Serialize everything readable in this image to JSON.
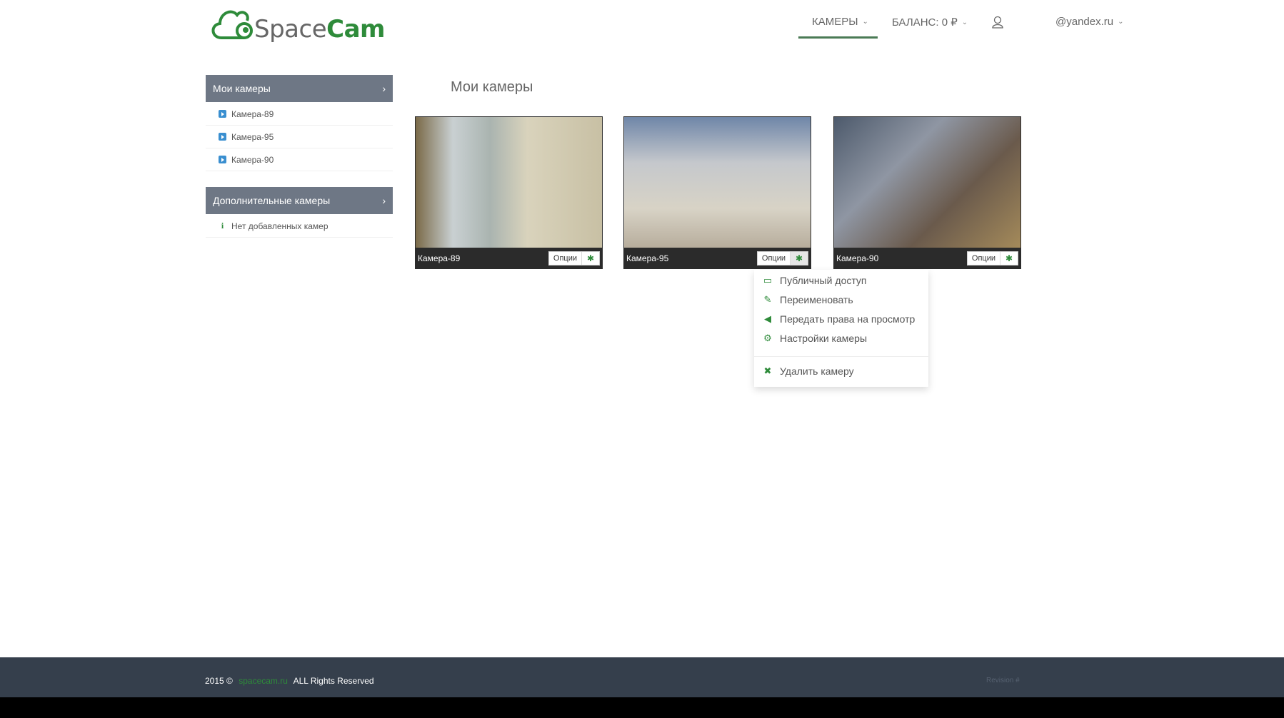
{
  "brand": {
    "name_light": "Space",
    "name_bold": "Cam",
    "color": "#2e8b3a"
  },
  "nav": {
    "cameras": "КАМЕРЫ",
    "balance": "БАЛАНС: 0 ₽",
    "user": "@yandex.ru"
  },
  "sidebar": {
    "my_header": "Мои камеры",
    "my_items": [
      {
        "label": "Камера-89"
      },
      {
        "label": "Камера-95"
      },
      {
        "label": "Камера-90"
      }
    ],
    "extra_header": "Дополнительные камеры",
    "extra_empty": "Нет добавленных камер"
  },
  "main": {
    "title": "Мои камеры",
    "cameras": [
      {
        "name": "Камера-89",
        "options": "Опции"
      },
      {
        "name": "Камера-95",
        "options": "Опции"
      },
      {
        "name": "Камера-90",
        "options": "Опции"
      }
    ]
  },
  "dropdown": {
    "items": [
      {
        "label": "Публичный доступ",
        "icon": "monitor-icon"
      },
      {
        "label": "Переименовать",
        "icon": "edit-icon"
      },
      {
        "label": "Передать права на просмотр",
        "icon": "bullhorn-icon"
      },
      {
        "label": "Настройки камеры",
        "icon": "cogs-icon"
      },
      {
        "label": "Удалить камеру",
        "icon": "remove-icon"
      }
    ]
  },
  "footer": {
    "year": "2015 ©",
    "link": "spacecam.ru",
    "rights": "ALL Rights Reserved",
    "revision": "Revision #"
  }
}
